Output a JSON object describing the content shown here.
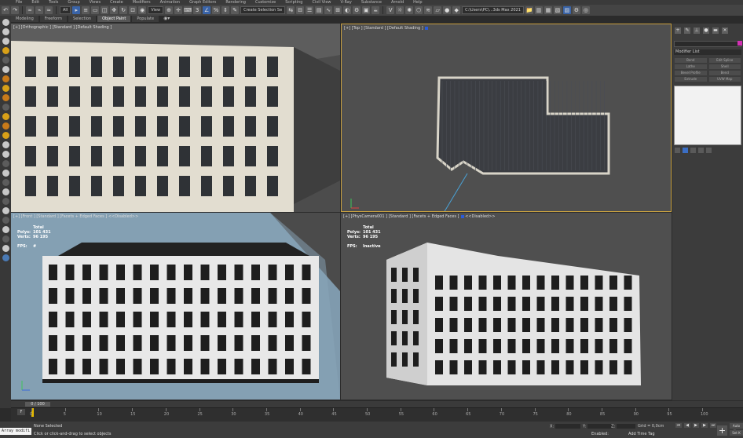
{
  "menubar": {
    "items": [
      "File",
      "Edit",
      "Tools",
      "Group",
      "Views",
      "Create",
      "Modifiers",
      "Animation",
      "Graph Editors",
      "Rendering",
      "Customize",
      "Scripting",
      "Civil View",
      "V-Ray",
      "Substance",
      "Arnold",
      "Help"
    ]
  },
  "toolbar": {
    "selection_filter": "All",
    "view_dropdown": "View",
    "named_selection_placeholder": "Create Selection Se",
    "workspace_path": "C:\\Users\\PC\\...3ds Max 2021"
  },
  "ribbon": {
    "tabs": [
      "Modeling",
      "Freeform",
      "Selection",
      "Object Paint",
      "Populate"
    ],
    "active_tab": "Object Paint"
  },
  "viewports": {
    "perspective": {
      "label": "[+] [Orthographic ] [Standard ] [Default Shading ]"
    },
    "top": {
      "label": "[+] [Top ] [Standard ] [Default Shading ]"
    },
    "front": {
      "label": "[+] [Front ] [Standard ] [Facets + Edged Faces ]",
      "disabled": "<<Disabled>>",
      "stats": {
        "total_label": "Total",
        "polys_label": "Polys:",
        "polys_value": "101 431",
        "verts_label": "Verts:",
        "verts_value": "96 195",
        "fps_label": "FPS:",
        "fps_value": "#"
      }
    },
    "camera": {
      "label": "[+] [PhysCamera001 ] [Standard ] [Facets + Edged Faces ]",
      "disabled": "<<Disabled>>",
      "stats": {
        "total_label": "Total",
        "polys_label": "Polys:",
        "polys_value": "101 431",
        "verts_label": "Verts:",
        "verts_value": "96 195",
        "fps_label": "FPS:",
        "fps_value": "Inactive"
      }
    }
  },
  "command_panel": {
    "modifier_list": "Modifier List",
    "buttons": [
      "Bend",
      "Edit Spline",
      "Lathe",
      "Shell",
      "Bevel Profile",
      "Bend",
      "Extrude",
      "UVW Map"
    ]
  },
  "timeline": {
    "frame_display": "0 / 100",
    "ticks": [
      0,
      5,
      10,
      15,
      20,
      25,
      30,
      35,
      40,
      45,
      50,
      55,
      60,
      65,
      70,
      75,
      80,
      85,
      90,
      95,
      100
    ]
  },
  "status": {
    "maxscript": "Array modifi",
    "selection": "None Selected",
    "prompt": "Click or click-and-drag to select objects",
    "x_label": "X:",
    "y_label": "Y:",
    "z_label": "Z:",
    "grid": "Grid = 0,0cm",
    "enabled": "Enabled:",
    "add_time_tag": "Add Time Tag",
    "auto_key": "Auto Key",
    "set_key": "Set K"
  },
  "colors": {
    "top_viewport_border": "#c8a040",
    "object_color": "#d22fb4",
    "time_cursor": "#e3b800"
  }
}
